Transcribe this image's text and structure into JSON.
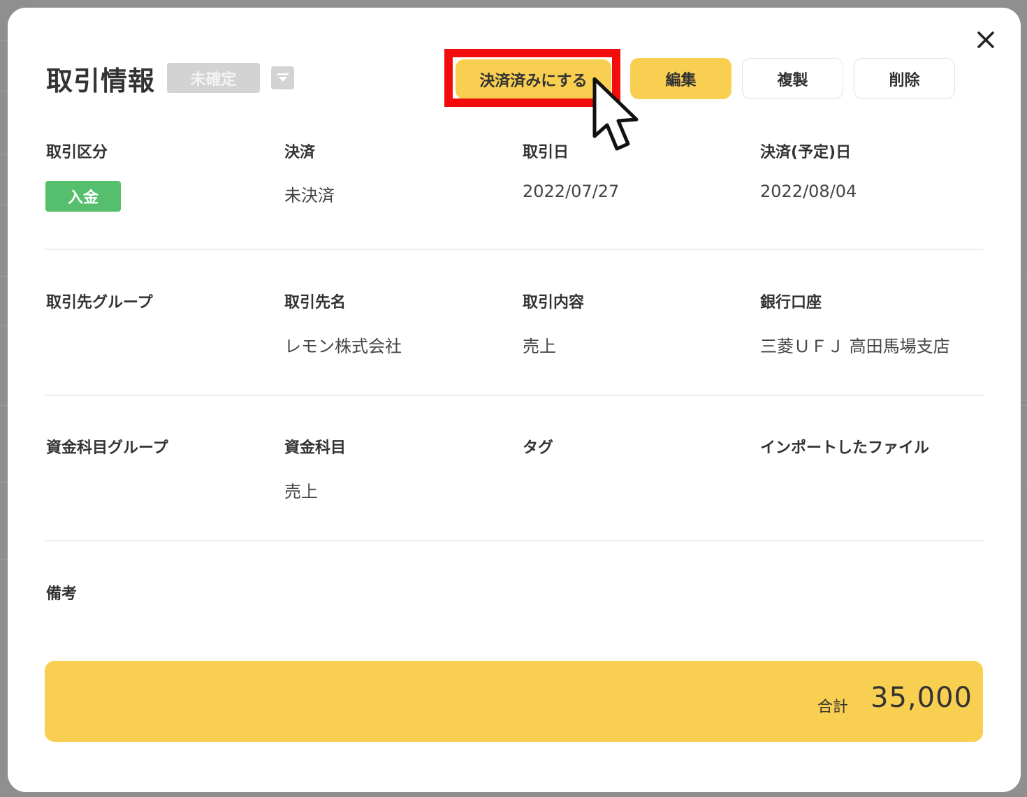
{
  "modal": {
    "title": "取引情報",
    "status_badge": "未確定",
    "close_icon": "close-icon",
    "dropdown_icon": "chevron-down-icon"
  },
  "toolbar": {
    "settle_label": "決済済みにする",
    "edit_label": "編集",
    "duplicate_label": "複製",
    "delete_label": "削除"
  },
  "rows": [
    {
      "fields": [
        {
          "label": "取引区分",
          "value": "入金"
        },
        {
          "label": "決済",
          "value": "未決済"
        },
        {
          "label": "取引日",
          "value": "2022/07/27"
        },
        {
          "label": "決済(予定)日",
          "value": "2022/08/04"
        }
      ]
    },
    {
      "fields": [
        {
          "label": "取引先グループ",
          "value": ""
        },
        {
          "label": "取引先名",
          "value": "レモン株式会社"
        },
        {
          "label": "取引内容",
          "value": "売上"
        },
        {
          "label": "銀行口座",
          "value": "三菱ＵＦＪ 高田馬場支店"
        }
      ]
    },
    {
      "fields": [
        {
          "label": "資金科目グループ",
          "value": ""
        },
        {
          "label": "資金科目",
          "value": "売上"
        },
        {
          "label": "タグ",
          "value": ""
        },
        {
          "label": "インポートしたファイル",
          "value": ""
        }
      ]
    }
  ],
  "memo": {
    "label": "備考",
    "value": ""
  },
  "total": {
    "label": "合計",
    "value": "35,000"
  },
  "colors": {
    "accent_yellow": "#f9cf52",
    "income_green": "#55bf6e",
    "highlight_red": "#f20c0c",
    "badge_gray": "#d3d3d3"
  }
}
